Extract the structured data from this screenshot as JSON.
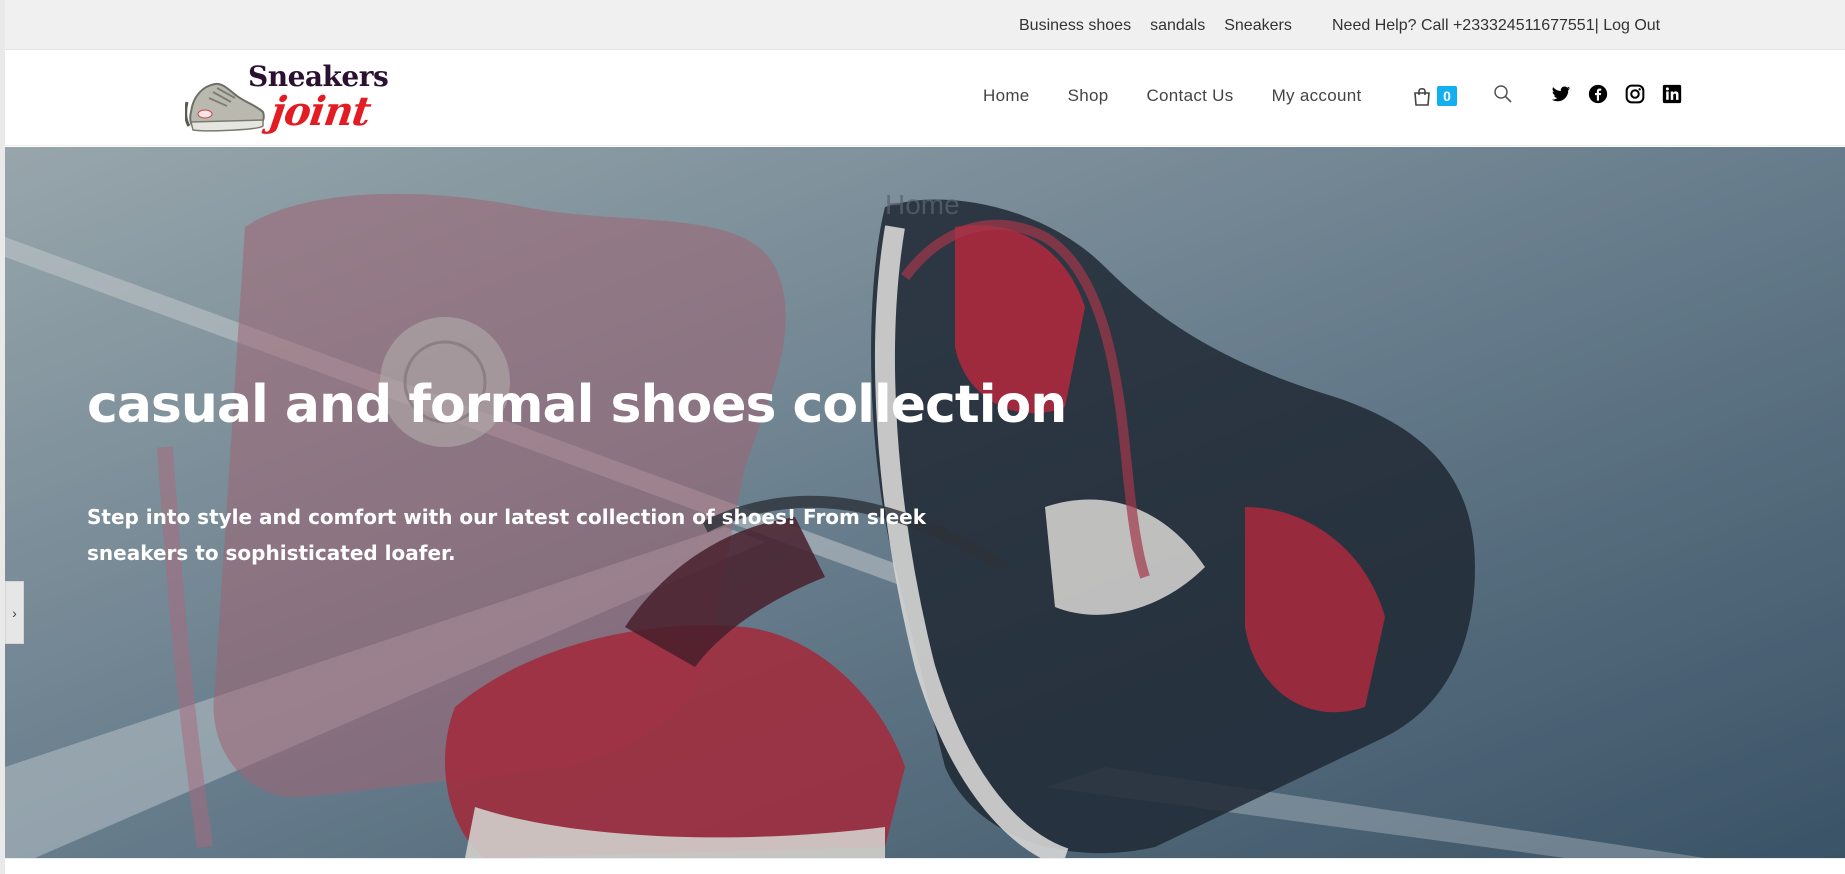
{
  "topbar": {
    "links": [
      "Business shoes",
      "sandals",
      "Sneakers"
    ],
    "help_text": "Need Help? Call +233324511677551| Log Out"
  },
  "logo": {
    "line1": "Sneakers",
    "line2": "joint"
  },
  "nav": {
    "items": [
      "Home",
      "Shop",
      "Contact Us",
      "My account"
    ]
  },
  "cart": {
    "count": "0",
    "icon": "shopping-bag-icon",
    "badge_color": "#13aff0"
  },
  "search": {
    "icon": "search-icon"
  },
  "socials": [
    "twitter-icon",
    "facebook-icon",
    "instagram-icon",
    "linkedin-icon"
  ],
  "hero": {
    "breadcrumb": "Home",
    "title": "casual and formal shoes collection",
    "text": "Step into style and comfort with our latest collection of shoes! From sleek sneakers to sophisticated loafer."
  },
  "slider": {
    "arrow": "›"
  },
  "colors": {
    "brand_purple": "#2b1032",
    "brand_red": "#e31b23",
    "accent_blue": "#13aff0"
  }
}
